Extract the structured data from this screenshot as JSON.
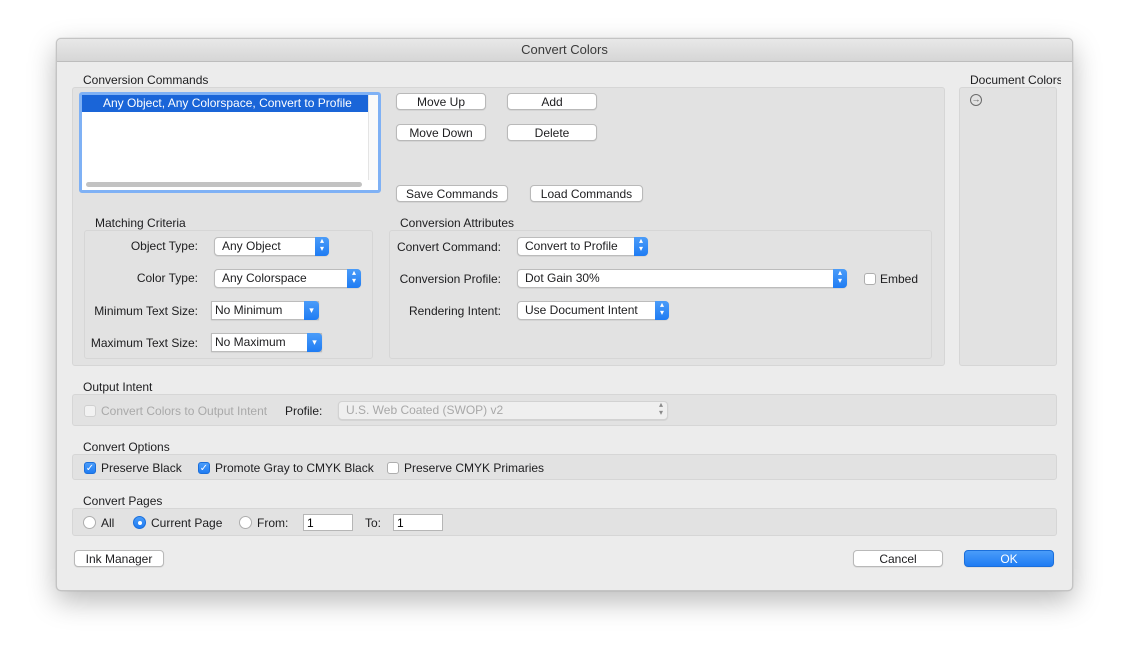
{
  "window": {
    "title": "Convert Colors"
  },
  "conversion_commands": {
    "label": "Conversion Commands",
    "list_items": [
      "Any Object, Any Colorspace, Convert to Profile"
    ],
    "buttons": {
      "move_up": "Move Up",
      "add": "Add",
      "move_down": "Move Down",
      "delete": "Delete",
      "save": "Save Commands",
      "load": "Load Commands"
    }
  },
  "document_colors": {
    "label": "Document Colors",
    "icon": "arrow-circle-right-icon"
  },
  "matching_criteria": {
    "label": "Matching Criteria",
    "object_type": {
      "label": "Object Type:",
      "value": "Any Object"
    },
    "color_type": {
      "label": "Color Type:",
      "value": "Any Colorspace"
    },
    "min_text_size": {
      "label": "Minimum Text Size:",
      "value": "No Minimum"
    },
    "max_text_size": {
      "label": "Maximum Text Size:",
      "value": "No Maximum"
    }
  },
  "conversion_attributes": {
    "label": "Conversion Attributes",
    "convert_command": {
      "label": "Convert Command:",
      "value": "Convert to Profile"
    },
    "conversion_profile": {
      "label": "Conversion Profile:",
      "value": "Dot Gain 30%"
    },
    "embed": {
      "label": "Embed",
      "checked": false
    },
    "rendering_intent": {
      "label": "Rendering Intent:",
      "value": "Use Document Intent"
    }
  },
  "output_intent": {
    "label": "Output Intent",
    "convert_to_output": {
      "label": "Convert Colors to Output Intent",
      "checked": false,
      "disabled": true
    },
    "profile": {
      "label": "Profile:",
      "value": "U.S. Web Coated (SWOP) v2",
      "disabled": true
    }
  },
  "convert_options": {
    "label": "Convert Options",
    "preserve_black": {
      "label": "Preserve Black",
      "checked": true
    },
    "promote_gray": {
      "label": "Promote Gray to CMYK Black",
      "checked": true
    },
    "preserve_cmyk": {
      "label": "Preserve CMYK Primaries",
      "checked": false
    }
  },
  "convert_pages": {
    "label": "Convert Pages",
    "all": "All",
    "current_page": "Current Page",
    "from": "From:",
    "from_value": "1",
    "to": "To:",
    "to_value": "1",
    "selected": "current_page"
  },
  "footer": {
    "ink_manager": "Ink Manager",
    "cancel": "Cancel",
    "ok": "OK"
  },
  "colors": {
    "accent": "#1f7cf3",
    "selection": "#1a65d8"
  }
}
